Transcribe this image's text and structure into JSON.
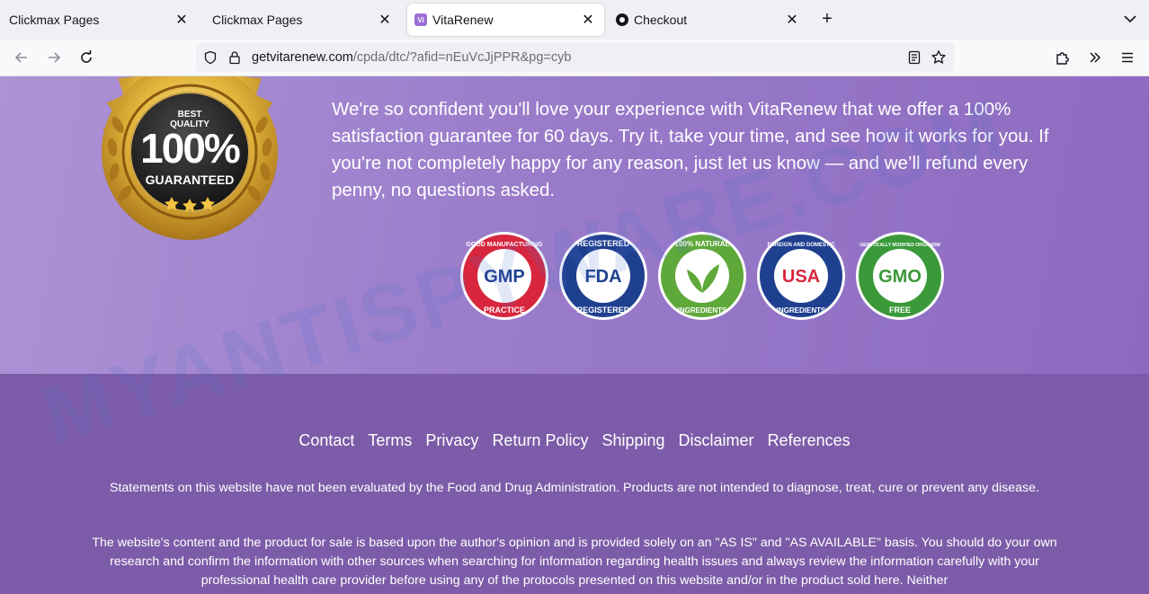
{
  "browser": {
    "tabs": [
      {
        "label": "Clickmax Pages",
        "active": false,
        "favicon": "none"
      },
      {
        "label": "Clickmax Pages",
        "active": false,
        "favicon": "none"
      },
      {
        "label": "VitaRenew",
        "active": true,
        "favicon": "vitarenew-favicon"
      },
      {
        "label": "Checkout",
        "active": false,
        "favicon": "checkout-favicon"
      }
    ],
    "url_domain": "getvitarenew.com",
    "url_path": "/cpda/dtc/?afid=nEuVcJjPPR&pg=cyb"
  },
  "seal": {
    "top_text": "BEST",
    "quality_text": "QUALITY",
    "percent_text": "100%",
    "bottom_text": "GUARANTEED"
  },
  "guarantee_text": "We're so confident you'll love your experience with VitaRenew that we offer a 100% satisfaction guarantee for 60 days. Try it, take your time, and see how it works for you. If you're not completely happy for any reason, just let us know — and we’ll refund every penny, no questions asked.",
  "badges": [
    {
      "center": "GMP",
      "ring_top": "GOOD MANUFACTURING",
      "ring_bottom": "PRACTICE",
      "color": "#d7263d"
    },
    {
      "center": "FDA",
      "ring_top": "REGISTERED",
      "ring_bottom": "REGISTERED",
      "color": "#1f3f8f"
    },
    {
      "center": "",
      "ring_top": "100% NATURAL",
      "ring_bottom": "INGREDIENTS",
      "color": "#5fa83a"
    },
    {
      "center": "USA",
      "ring_top": "FOREIGN AND DOMESTIC",
      "ring_bottom": "INGREDIENTS",
      "color": "#1f3f8f"
    },
    {
      "center": "GMO",
      "ring_top": "GENETICALLY MODIFIED ORGANISM",
      "ring_bottom": "FREE",
      "color": "#3a9a3a"
    }
  ],
  "footer": {
    "links": [
      "Contact",
      "Terms",
      "Privacy",
      "Return Policy",
      "Shipping",
      "Disclaimer",
      "References"
    ],
    "disclaimer_1": "Statements on this website have not been evaluated by the Food and Drug Administration. Products are not intended to diagnose, treat, cure or prevent any disease.",
    "disclaimer_2": "The website's content and the product for sale is based upon the author's opinion and is provided solely on an \"AS IS\" and \"AS AVAILABLE\" basis. You should do your own research and confirm the information with other sources when searching for information regarding health issues and always review the information carefully with your professional health care provider before using any of the protocols presented on this website and/or in the product sold here. Neither"
  },
  "watermark_text": "MYANTISPYWARE.COM"
}
